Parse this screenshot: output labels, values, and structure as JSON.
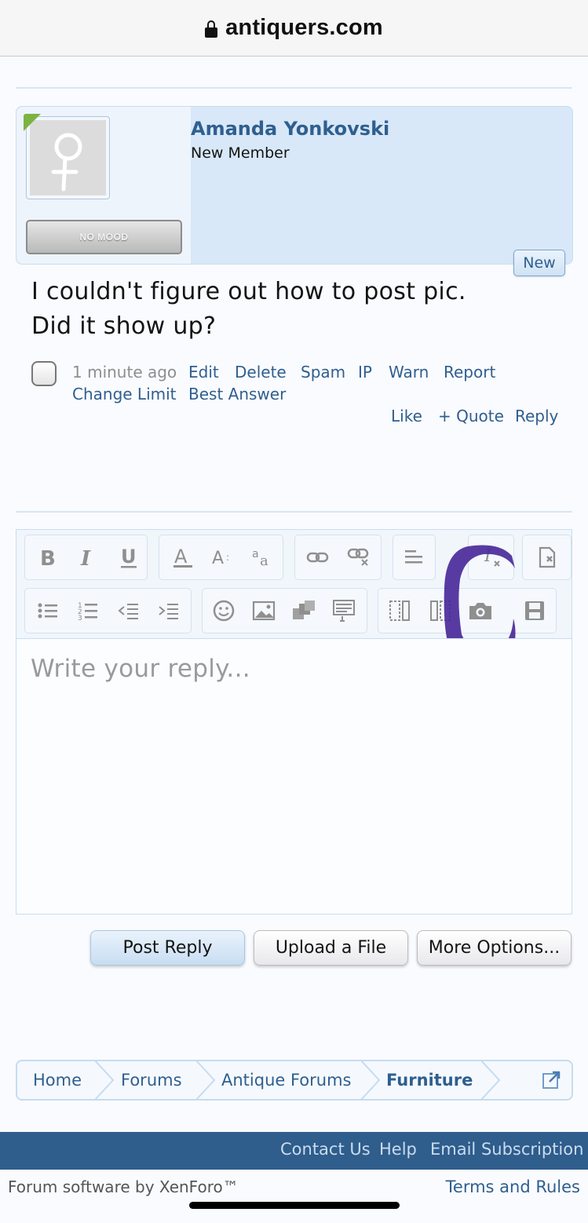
{
  "browser": {
    "domain": "antiquers.com"
  },
  "post": {
    "username": "Amanda Yonkovski",
    "user_title": "New Member",
    "mood": "NO MOOD",
    "new_badge": "New",
    "message_line1": "I couldn't figure out how to post pic.",
    "message_line2": "Did it show up?",
    "time": "1 minute ago",
    "actions": {
      "edit": "Edit",
      "delete": "Delete",
      "spam": "Spam",
      "ip": "IP",
      "warn": "Warn",
      "report": "Report",
      "change_limit": "Change Limit",
      "best_answer": "Best Answer",
      "like": "Like",
      "quote": "+ Quote",
      "reply": "Reply"
    }
  },
  "editor": {
    "toolbar_row1": [
      "bold-icon",
      "italic-icon",
      "underline-icon",
      "font-color-icon",
      "font-size-icon",
      "font-family-icon",
      "link-icon",
      "unlink-icon",
      "align-icon",
      "remove-format-icon",
      "bb-code-icon"
    ],
    "toolbar_row2": [
      "bullet-list-icon",
      "numbered-list-icon",
      "outdent-icon",
      "indent-icon",
      "smilie-icon",
      "image-icon",
      "media-icon",
      "quote-block-icon",
      "insert-before-icon",
      "insert-after-icon",
      "camera-icon",
      "save-draft-icon"
    ],
    "placeholder": "Write your reply..."
  },
  "buttons": {
    "post_reply": "Post Reply",
    "upload_file": "Upload a File",
    "more_options": "More Options..."
  },
  "breadcrumb": {
    "home": "Home",
    "forums": "Forums",
    "antique_forums": "Antique Forums",
    "current": "Furniture"
  },
  "footer": {
    "contact": "Contact Us",
    "help": "Help",
    "email": "Email Subscription",
    "copyright": "Forum software by XenForo™",
    "terms": "Terms and Rules"
  },
  "colors": {
    "link": "#2f5f8f",
    "footer_bar": "#2f5d8c",
    "user_panel": "#d8e8f8",
    "annotation": "#4a2a9a"
  }
}
